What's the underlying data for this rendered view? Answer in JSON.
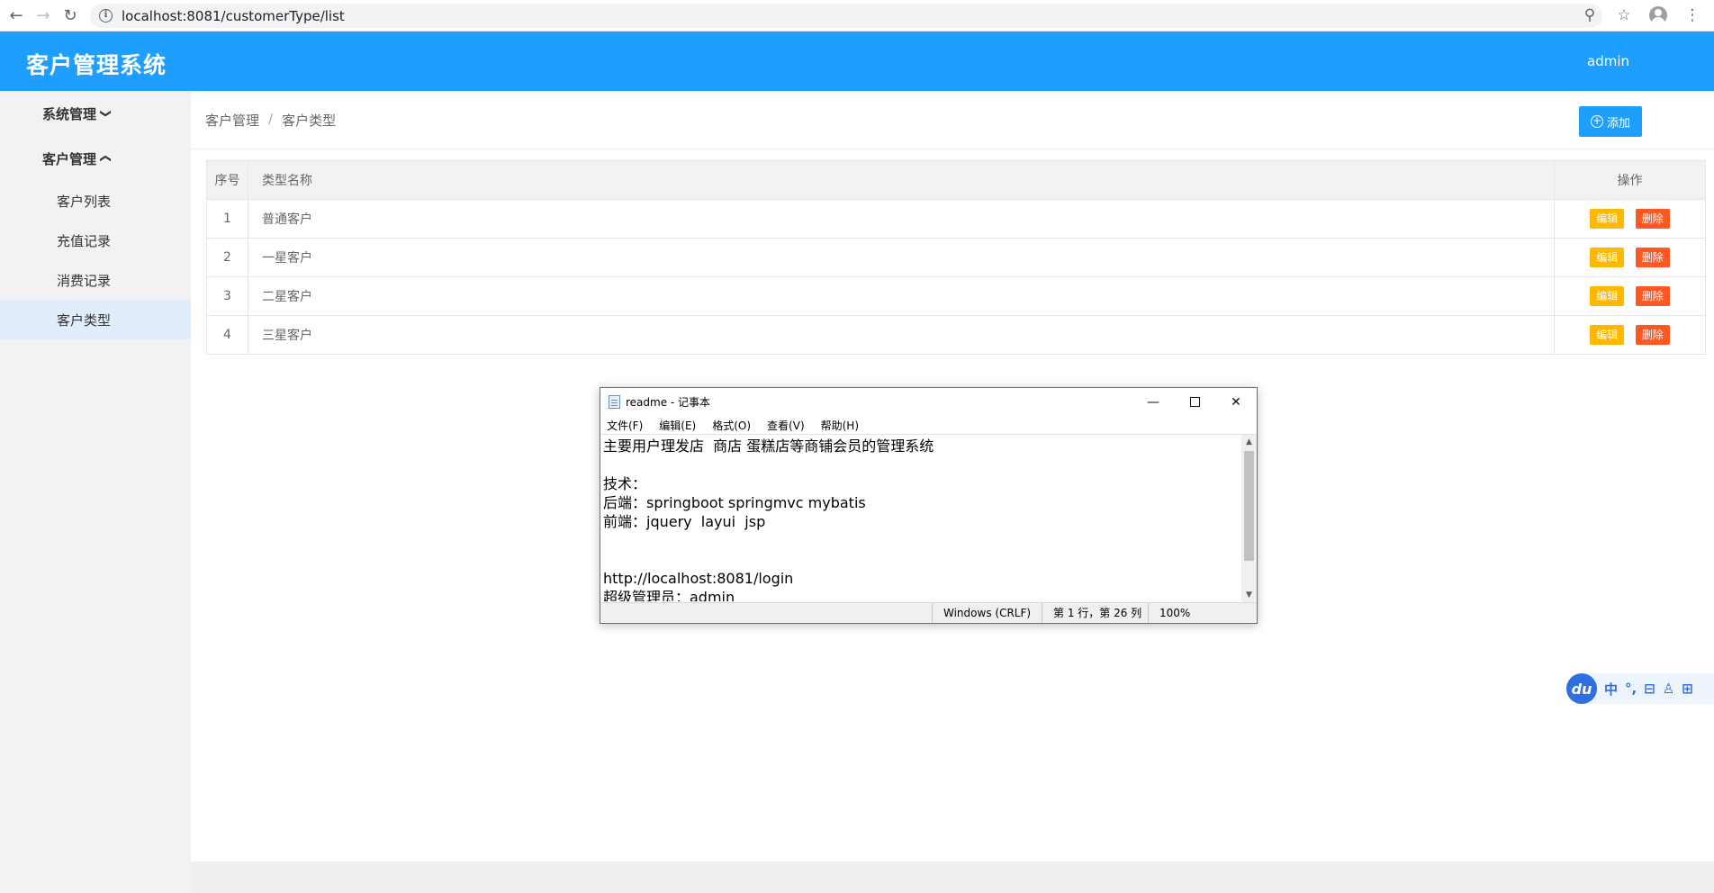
{
  "browser": {
    "url": "localhost:8081/customerType/list",
    "back_icon": "←",
    "forward_icon": "→",
    "reload_icon": "↻",
    "zoom_icon": "⚲",
    "star_icon": "☆",
    "menu_icon": "⋮"
  },
  "header": {
    "title": "客户管理系统",
    "user": "admin",
    "color": "#1e9fff"
  },
  "sidebar": {
    "groups": [
      {
        "label": "系统管理",
        "chevron": "❯"
      },
      {
        "label": "客户管理",
        "chevron": "❮"
      }
    ],
    "items": [
      {
        "label": "客户列表"
      },
      {
        "label": "充值记录"
      },
      {
        "label": "消费记录"
      },
      {
        "label": "客户类型"
      }
    ]
  },
  "breadcrumb": {
    "parent": "客户管理",
    "separator": "/",
    "current": "客户类型"
  },
  "toolbar": {
    "add_label": "添加",
    "add_icon": "+"
  },
  "table": {
    "headers": {
      "index": "序号",
      "name": "类型名称",
      "ops": "操作"
    },
    "edit_label": "编辑",
    "delete_label": "删除",
    "rows": [
      {
        "index": "1",
        "name": "普通客户"
      },
      {
        "index": "2",
        "name": "一星客户"
      },
      {
        "index": "3",
        "name": "二星客户"
      },
      {
        "index": "4",
        "name": "三星客户"
      }
    ]
  },
  "notepad": {
    "title": "readme - 记事本",
    "minimize": "—",
    "close": "✕",
    "menus": [
      "文件(F)",
      "编辑(E)",
      "格式(O)",
      "查看(V)",
      "帮助(H)"
    ],
    "content": "主要用户理发店  商店 蛋糕店等商铺会员的管理系统\n\n技术：\n后端：springboot springmvc mybatis\n前端：jquery  layui  jsp\n\n\nhttp://localhost:8081/login\n超级管理员：admin",
    "scroll_up": "▲",
    "scroll_down": "▼",
    "status": {
      "encoding": "Windows (CRLF)",
      "position": "第 1 行，第 26 列",
      "zoom": "100%"
    }
  },
  "ime": {
    "logo": "du",
    "items": [
      "中",
      "°,",
      "⊟",
      "♙",
      "⊞"
    ]
  }
}
